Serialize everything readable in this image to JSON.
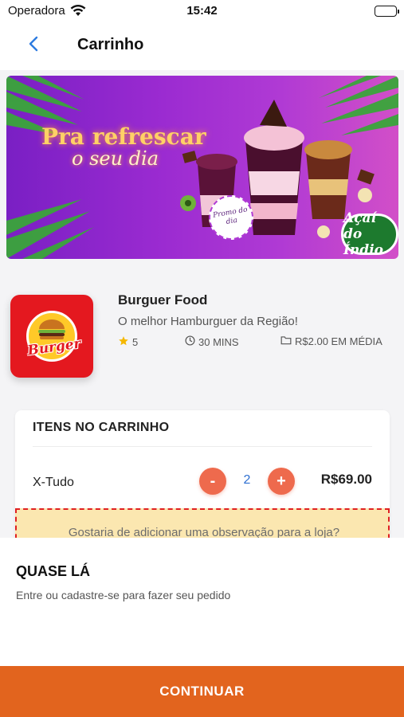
{
  "status_bar": {
    "carrier": "Operadora",
    "time": "15:42",
    "icons": [
      "wifi-icon",
      "battery-icon"
    ]
  },
  "header": {
    "title": "Carrinho",
    "back_icon": "chevron-left-icon"
  },
  "banner": {
    "headline_line1": "Pra refrescar",
    "headline_line2": "o seu dia",
    "promo_stamp": "Promo do dia",
    "brand": "Açaí do Índio",
    "colors": {
      "background_start": "#7a1fc4",
      "background_end": "#d24fc8",
      "headline": "#ffd166",
      "leaves": "#3aa63a"
    }
  },
  "store": {
    "logo_text": "Burger",
    "name": "Burguer Food",
    "description": "O melhor Hamburguer da Região!",
    "rating": "5",
    "delivery_time": "30 MINS",
    "average_price": "R$2.00 EM MÉDIA",
    "icons": [
      "star-icon",
      "clock-icon",
      "folder-icon"
    ],
    "colors": {
      "logo_background": "#e4181f",
      "star": "#f5b800"
    }
  },
  "cart": {
    "heading": "ITENS NO CARRINHO",
    "items": [
      {
        "name": "X-Tudo",
        "quantity": "2",
        "price": "R$69.00",
        "decrement_label": "-",
        "increment_label": "+"
      }
    ],
    "note_prompt": "Gostaria de adicionar uma observação para a loja?",
    "colors": {
      "qty_button": "#ee6a4d",
      "qty_value": "#2d6fd1",
      "note_background": "#fbe7b0",
      "note_border": "#e02020"
    }
  },
  "sheet": {
    "title": "QUASE LÁ",
    "subtitle": "Entre ou cadastre-se para fazer seu pedido",
    "continue_label": "CONTINUAR",
    "colors": {
      "continue_button": "#e2641e"
    }
  }
}
